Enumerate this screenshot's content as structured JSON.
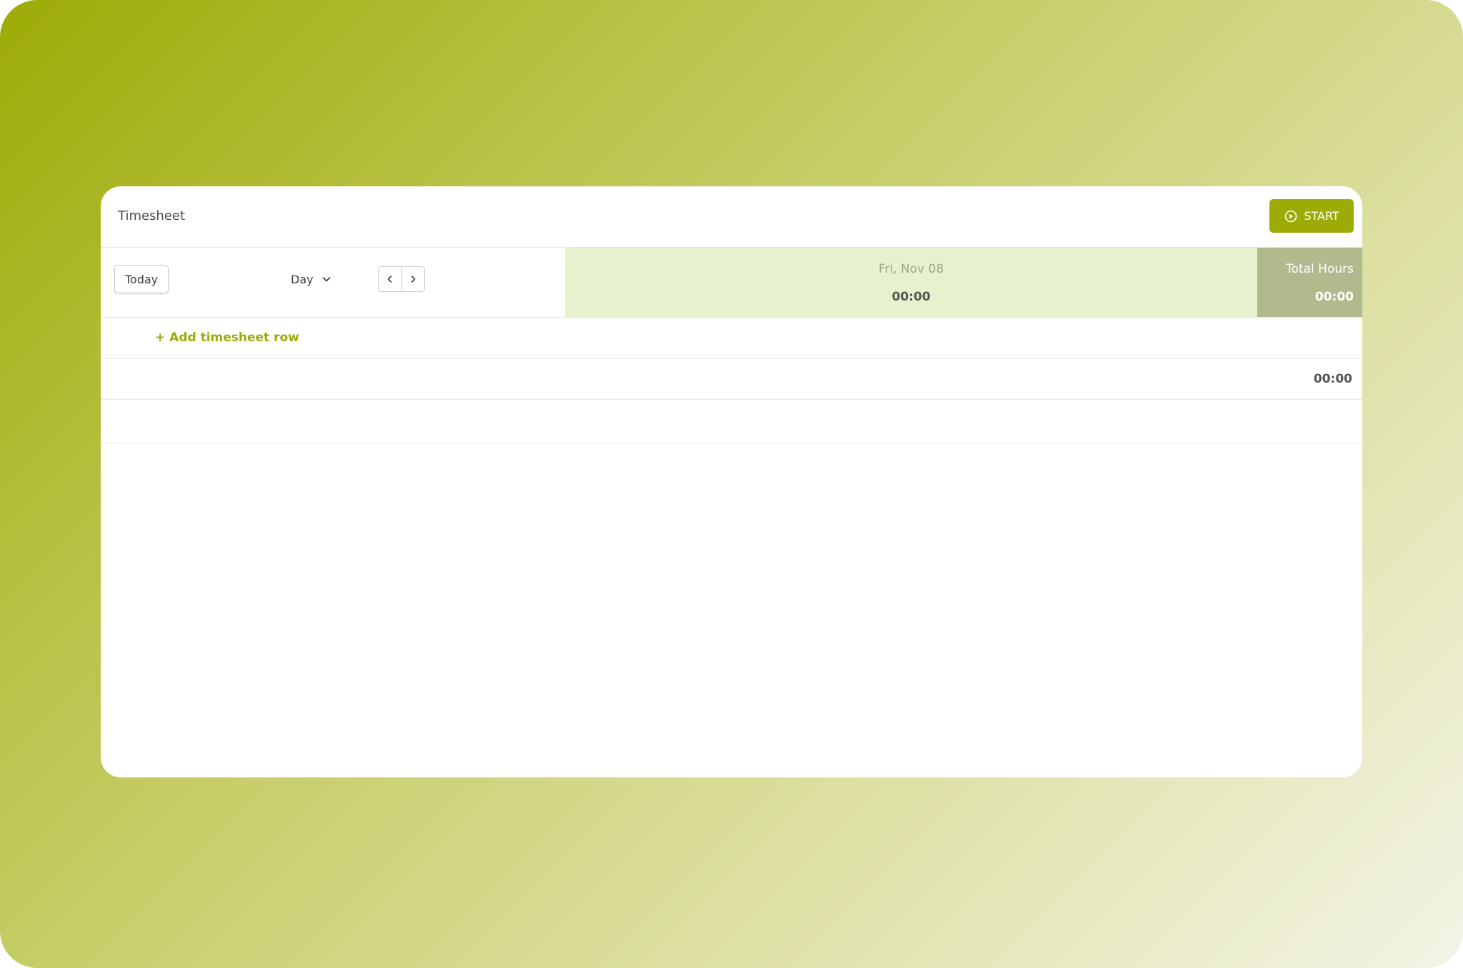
{
  "header": {
    "title": "Timesheet",
    "start_label": "START",
    "start_icon": "play-circle-icon"
  },
  "toolbar": {
    "today_label": "Today",
    "view_value": "Day",
    "view_icon": "chevron-down-icon",
    "prev_icon": "chevron-left-icon",
    "next_icon": "chevron-right-icon"
  },
  "grid": {
    "day_label": "Fri, Nov 08",
    "day_total": "00:00",
    "total_label": "Total Hours",
    "total_value": "00:00",
    "add_row_label": "+ Add timesheet row",
    "footer_total": "00:00"
  },
  "colors": {
    "accent": "#9dab06",
    "day_column_bg": "#e6f1cd",
    "total_column_bg": "#b0ba8d"
  }
}
